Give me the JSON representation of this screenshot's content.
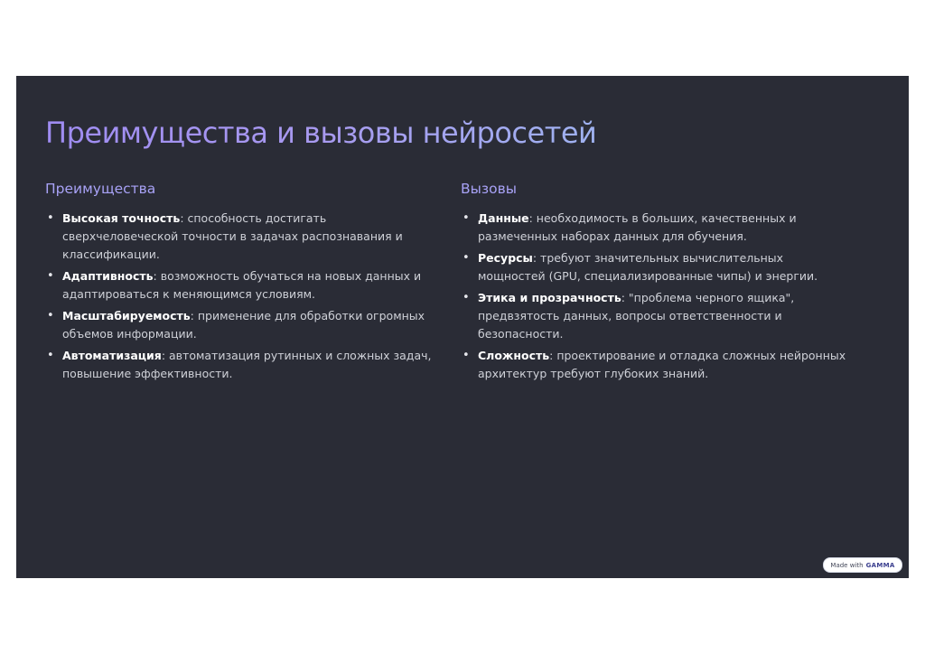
{
  "slide": {
    "title": "Преимущества и вызовы нейросетей",
    "columns": [
      {
        "heading": "Преимущества",
        "items": [
          {
            "term": "Высокая точность",
            "text": ": способность достигать сверхчеловеческой точности в задачах распознавания и классификации."
          },
          {
            "term": "Адаптивность",
            "text": ": возможность обучаться на новых данных и адаптироваться к меняющимся условиям."
          },
          {
            "term": "Масштабируемость",
            "text": ": применение для обработки огромных объемов информации."
          },
          {
            "term": "Автоматизация",
            "text": ": автоматизация рутинных и сложных задач, повышение эффективности."
          }
        ]
      },
      {
        "heading": "Вызовы",
        "items": [
          {
            "term": "Данные",
            "text": ": необходимость в больших, качественных и размеченных наборах данных для обучения."
          },
          {
            "term": "Ресурсы",
            "text": ": требуют значительных вычислительных мощностей (GPU, специализированные чипы) и энергии."
          },
          {
            "term": "Этика и прозрачность",
            "text": ": \"проблема черного ящика\", предвзятость данных, вопросы ответственности и безопасности."
          },
          {
            "term": "Сложность",
            "text": ": проектирование и отладка сложных нейронных архитектур требуют глубоких знаний."
          }
        ]
      }
    ]
  },
  "badge": {
    "prefix": "Made with",
    "brand": "GAMMA"
  },
  "colors": {
    "background": "#2a2c36",
    "heading": "#a8a2f6",
    "title_gradient_start": "#9f8cf2",
    "title_gradient_end": "#9fb2f0"
  },
  "bullet_glyph": "•"
}
